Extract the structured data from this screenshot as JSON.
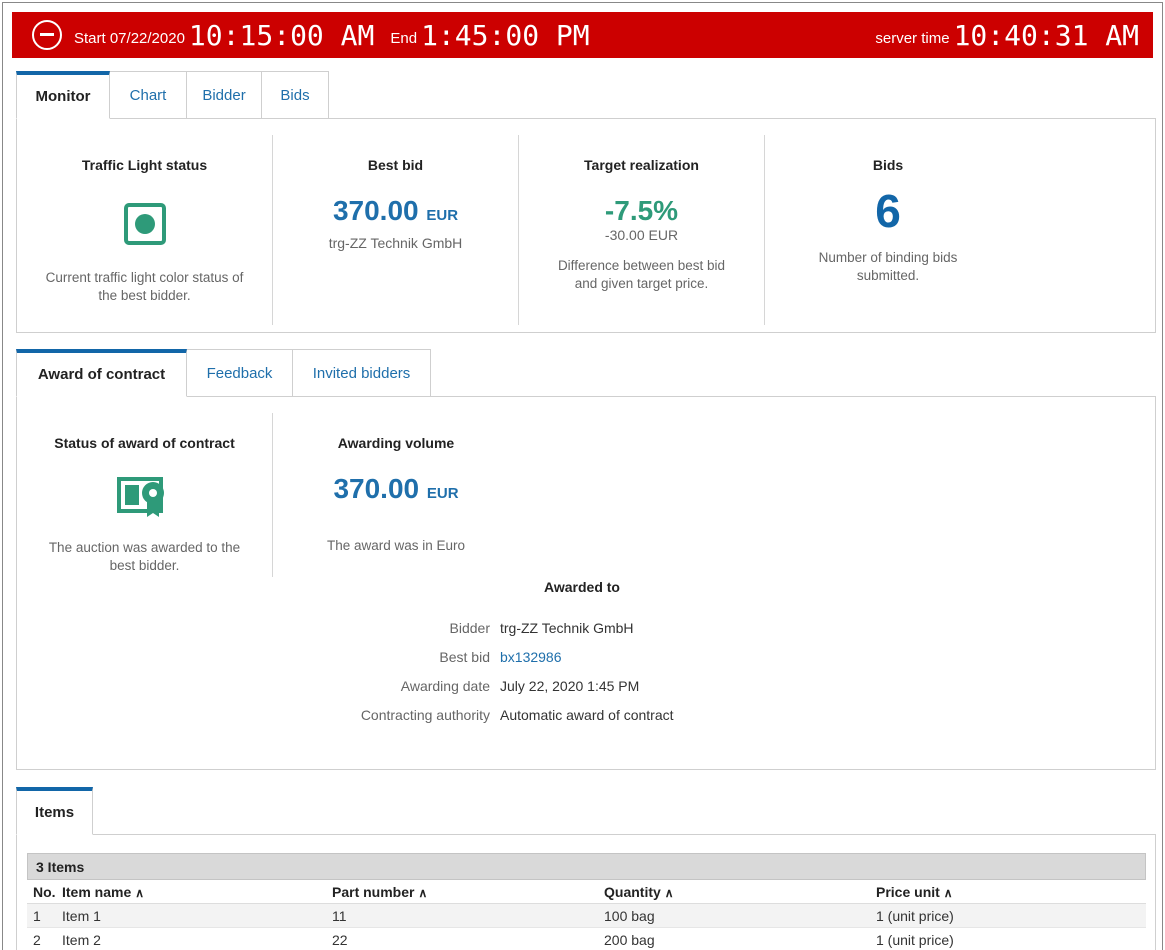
{
  "header": {
    "start_label": "Start 07/22/2020",
    "start_time": "10:15:00 AM",
    "end_label": "End",
    "end_time": "1:45:00 PM",
    "server_label": "server time",
    "server_time": "10:40:31 AM",
    "bar_color": "#cc0000"
  },
  "monitor_tabs": [
    "Monitor",
    "Chart",
    "Bidder",
    "Bids"
  ],
  "monitor": {
    "traffic": {
      "title": "Traffic Light status",
      "desc": "Current traffic light color status of the best bidder.",
      "status_color": "#2e9a79"
    },
    "best_bid": {
      "title": "Best bid",
      "value": "370.00",
      "currency": "EUR",
      "bidder": "trg-ZZ Technik GmbH"
    },
    "target": {
      "title": "Target realization",
      "value": "-7.5%",
      "diff": "-30.00 EUR",
      "desc": "Difference between best bid and given target price."
    },
    "bids": {
      "title": "Bids",
      "value": "6",
      "desc": "Number of binding bids submitted."
    }
  },
  "award_tabs": [
    "Award of contract",
    "Feedback",
    "Invited bidders"
  ],
  "award": {
    "status": {
      "title": "Status of award of contract",
      "desc": "The auction was awarded to the best bidder."
    },
    "volume": {
      "title": "Awarding volume",
      "value": "370.00",
      "currency": "EUR",
      "desc": "The award was in Euro"
    },
    "awarded_to_title": "Awarded to",
    "details": [
      {
        "key": "Bidder",
        "value": "trg-ZZ Technik GmbH"
      },
      {
        "key": "Best bid",
        "value": "bx132986"
      },
      {
        "key": "Awarding date",
        "value": "July 22, 2020 1:45 PM"
      },
      {
        "key": "Contracting authority",
        "value": "Automatic award of contract"
      }
    ]
  },
  "items_tab": "Items",
  "items": {
    "caption": "3 Items",
    "columns": [
      "No.",
      "Item name",
      "Part number",
      "Quantity",
      "Price unit"
    ],
    "rows": [
      [
        "1",
        "Item 1",
        "11",
        "100 bag",
        "1 (unit price)"
      ],
      [
        "2",
        "Item 2",
        "22",
        "200 bag",
        "1 (unit price)"
      ]
    ]
  },
  "icons": {
    "stop": "stop-circle-icon",
    "traffic": "traffic-light-icon",
    "award": "award-certificate-icon",
    "sort": "sort-ascending-icon"
  }
}
